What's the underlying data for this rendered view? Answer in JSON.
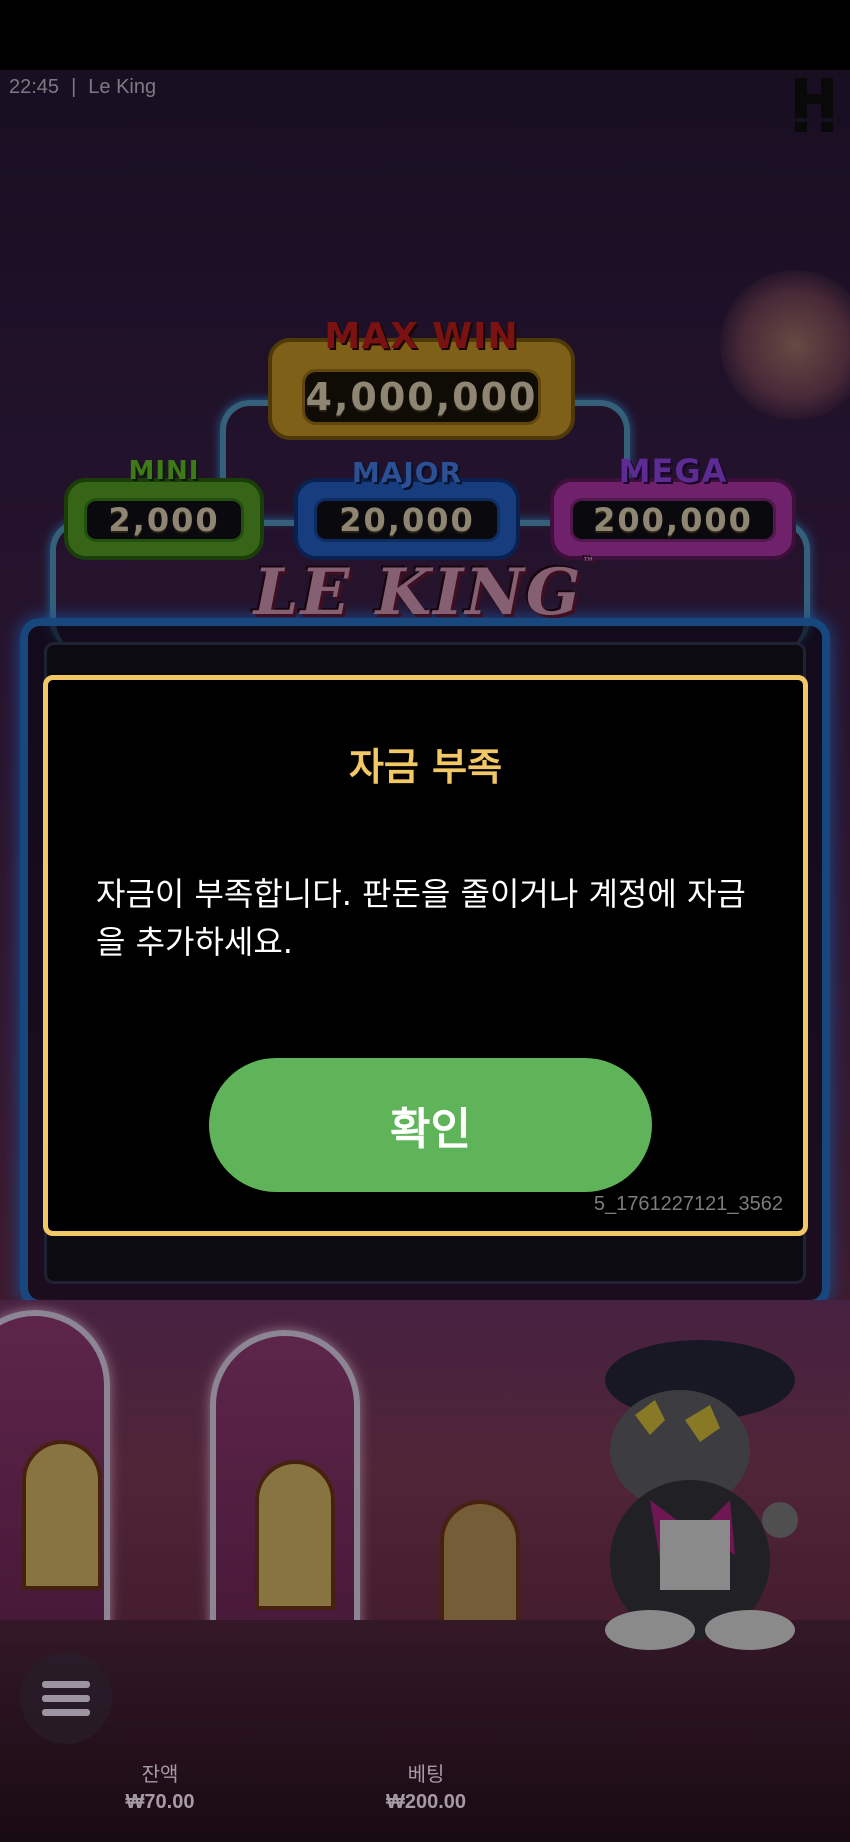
{
  "status": {
    "time": "22:45",
    "separator": "|",
    "game_title": "Le King"
  },
  "jackpots": {
    "max_win": {
      "label": "MAX WIN",
      "value": "4,000,000"
    },
    "mini": {
      "label": "MINI",
      "value": "2,000"
    },
    "major": {
      "label": "MAJOR",
      "value": "20,000"
    },
    "mega": {
      "label": "MEGA",
      "value": "200,000"
    }
  },
  "game_logo": {
    "text": "LE KING",
    "tm": "™"
  },
  "modal": {
    "title": "자금 부족",
    "message": "자금이 부족합니다. 판돈을 줄이거나 계정에 자금을 추가하세요.",
    "confirm_label": "확인",
    "code": "5_1761227121_3562"
  },
  "bottom_bar": {
    "balance_label": "잔액",
    "balance_value": "₩70.00",
    "bet_label": "베팅",
    "bet_value": "₩200.00"
  },
  "colors": {
    "modal_border": "#f2c766",
    "modal_title": "#f2c766",
    "confirm_button": "#5fb45a",
    "neon_frame": "#2a7ad9"
  },
  "icons": {
    "menu": "hamburger-menu-icon",
    "brand": "hacksaw-logo-icon"
  }
}
